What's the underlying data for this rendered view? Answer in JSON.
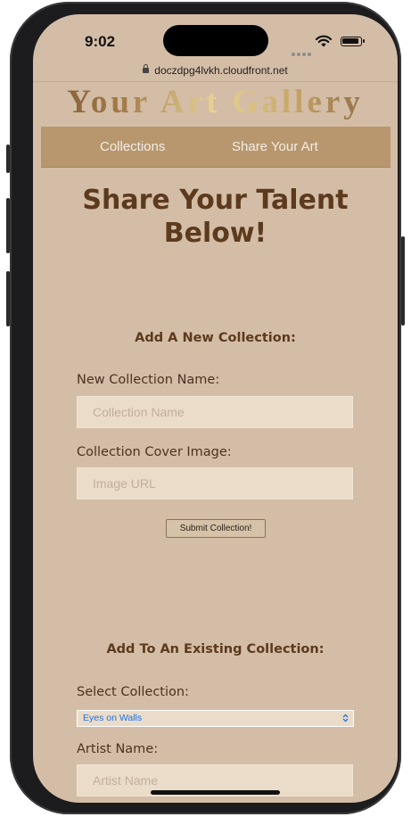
{
  "status_bar": {
    "time": "9:02"
  },
  "browser": {
    "url": "doczdpg4lvkh.cloudfront.net"
  },
  "site": {
    "title": "Your Art Gallery"
  },
  "nav": {
    "items": [
      {
        "label": "Collections"
      },
      {
        "label": "Share Your Art"
      }
    ]
  },
  "page": {
    "headline": "Share Your Talent Below!"
  },
  "new_collection": {
    "section_title": "Add A New Collection:",
    "name_label": "New Collection Name:",
    "name_placeholder": "Collection Name",
    "image_label": "Collection Cover Image:",
    "image_placeholder": "Image URL",
    "submit_label": "Submit Collection!"
  },
  "existing_collection": {
    "section_title": "Add To An Existing Collection:",
    "select_label": "Select Collection:",
    "select_value": "Eyes on Walls",
    "artist_label": "Artist Name:",
    "artist_placeholder": "Artist Name"
  },
  "colors": {
    "page_background": "#d4bda6",
    "nav_background": "#b8976f",
    "heading_brown": "#5c3a1e",
    "input_background": "#ebdcc9",
    "select_text_blue": "#1a73e8"
  }
}
